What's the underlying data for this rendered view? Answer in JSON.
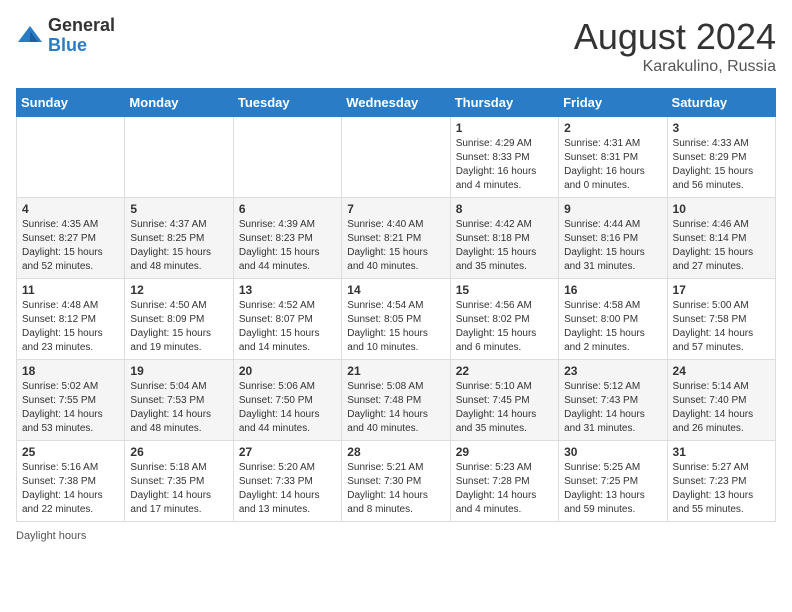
{
  "header": {
    "logo_general": "General",
    "logo_blue": "Blue",
    "title": "August 2024",
    "location": "Karakulino, Russia"
  },
  "days_of_week": [
    "Sunday",
    "Monday",
    "Tuesday",
    "Wednesday",
    "Thursday",
    "Friday",
    "Saturday"
  ],
  "weeks": [
    [
      {
        "day": "",
        "info": ""
      },
      {
        "day": "",
        "info": ""
      },
      {
        "day": "",
        "info": ""
      },
      {
        "day": "",
        "info": ""
      },
      {
        "day": "1",
        "info": "Sunrise: 4:29 AM\nSunset: 8:33 PM\nDaylight: 16 hours and 4 minutes."
      },
      {
        "day": "2",
        "info": "Sunrise: 4:31 AM\nSunset: 8:31 PM\nDaylight: 16 hours and 0 minutes."
      },
      {
        "day": "3",
        "info": "Sunrise: 4:33 AM\nSunset: 8:29 PM\nDaylight: 15 hours and 56 minutes."
      }
    ],
    [
      {
        "day": "4",
        "info": "Sunrise: 4:35 AM\nSunset: 8:27 PM\nDaylight: 15 hours and 52 minutes."
      },
      {
        "day": "5",
        "info": "Sunrise: 4:37 AM\nSunset: 8:25 PM\nDaylight: 15 hours and 48 minutes."
      },
      {
        "day": "6",
        "info": "Sunrise: 4:39 AM\nSunset: 8:23 PM\nDaylight: 15 hours and 44 minutes."
      },
      {
        "day": "7",
        "info": "Sunrise: 4:40 AM\nSunset: 8:21 PM\nDaylight: 15 hours and 40 minutes."
      },
      {
        "day": "8",
        "info": "Sunrise: 4:42 AM\nSunset: 8:18 PM\nDaylight: 15 hours and 35 minutes."
      },
      {
        "day": "9",
        "info": "Sunrise: 4:44 AM\nSunset: 8:16 PM\nDaylight: 15 hours and 31 minutes."
      },
      {
        "day": "10",
        "info": "Sunrise: 4:46 AM\nSunset: 8:14 PM\nDaylight: 15 hours and 27 minutes."
      }
    ],
    [
      {
        "day": "11",
        "info": "Sunrise: 4:48 AM\nSunset: 8:12 PM\nDaylight: 15 hours and 23 minutes."
      },
      {
        "day": "12",
        "info": "Sunrise: 4:50 AM\nSunset: 8:09 PM\nDaylight: 15 hours and 19 minutes."
      },
      {
        "day": "13",
        "info": "Sunrise: 4:52 AM\nSunset: 8:07 PM\nDaylight: 15 hours and 14 minutes."
      },
      {
        "day": "14",
        "info": "Sunrise: 4:54 AM\nSunset: 8:05 PM\nDaylight: 15 hours and 10 minutes."
      },
      {
        "day": "15",
        "info": "Sunrise: 4:56 AM\nSunset: 8:02 PM\nDaylight: 15 hours and 6 minutes."
      },
      {
        "day": "16",
        "info": "Sunrise: 4:58 AM\nSunset: 8:00 PM\nDaylight: 15 hours and 2 minutes."
      },
      {
        "day": "17",
        "info": "Sunrise: 5:00 AM\nSunset: 7:58 PM\nDaylight: 14 hours and 57 minutes."
      }
    ],
    [
      {
        "day": "18",
        "info": "Sunrise: 5:02 AM\nSunset: 7:55 PM\nDaylight: 14 hours and 53 minutes."
      },
      {
        "day": "19",
        "info": "Sunrise: 5:04 AM\nSunset: 7:53 PM\nDaylight: 14 hours and 48 minutes."
      },
      {
        "day": "20",
        "info": "Sunrise: 5:06 AM\nSunset: 7:50 PM\nDaylight: 14 hours and 44 minutes."
      },
      {
        "day": "21",
        "info": "Sunrise: 5:08 AM\nSunset: 7:48 PM\nDaylight: 14 hours and 40 minutes."
      },
      {
        "day": "22",
        "info": "Sunrise: 5:10 AM\nSunset: 7:45 PM\nDaylight: 14 hours and 35 minutes."
      },
      {
        "day": "23",
        "info": "Sunrise: 5:12 AM\nSunset: 7:43 PM\nDaylight: 14 hours and 31 minutes."
      },
      {
        "day": "24",
        "info": "Sunrise: 5:14 AM\nSunset: 7:40 PM\nDaylight: 14 hours and 26 minutes."
      }
    ],
    [
      {
        "day": "25",
        "info": "Sunrise: 5:16 AM\nSunset: 7:38 PM\nDaylight: 14 hours and 22 minutes."
      },
      {
        "day": "26",
        "info": "Sunrise: 5:18 AM\nSunset: 7:35 PM\nDaylight: 14 hours and 17 minutes."
      },
      {
        "day": "27",
        "info": "Sunrise: 5:20 AM\nSunset: 7:33 PM\nDaylight: 14 hours and 13 minutes."
      },
      {
        "day": "28",
        "info": "Sunrise: 5:21 AM\nSunset: 7:30 PM\nDaylight: 14 hours and 8 minutes."
      },
      {
        "day": "29",
        "info": "Sunrise: 5:23 AM\nSunset: 7:28 PM\nDaylight: 14 hours and 4 minutes."
      },
      {
        "day": "30",
        "info": "Sunrise: 5:25 AM\nSunset: 7:25 PM\nDaylight: 13 hours and 59 minutes."
      },
      {
        "day": "31",
        "info": "Sunrise: 5:27 AM\nSunset: 7:23 PM\nDaylight: 13 hours and 55 minutes."
      }
    ]
  ],
  "footer": {
    "daylight_label": "Daylight hours"
  }
}
